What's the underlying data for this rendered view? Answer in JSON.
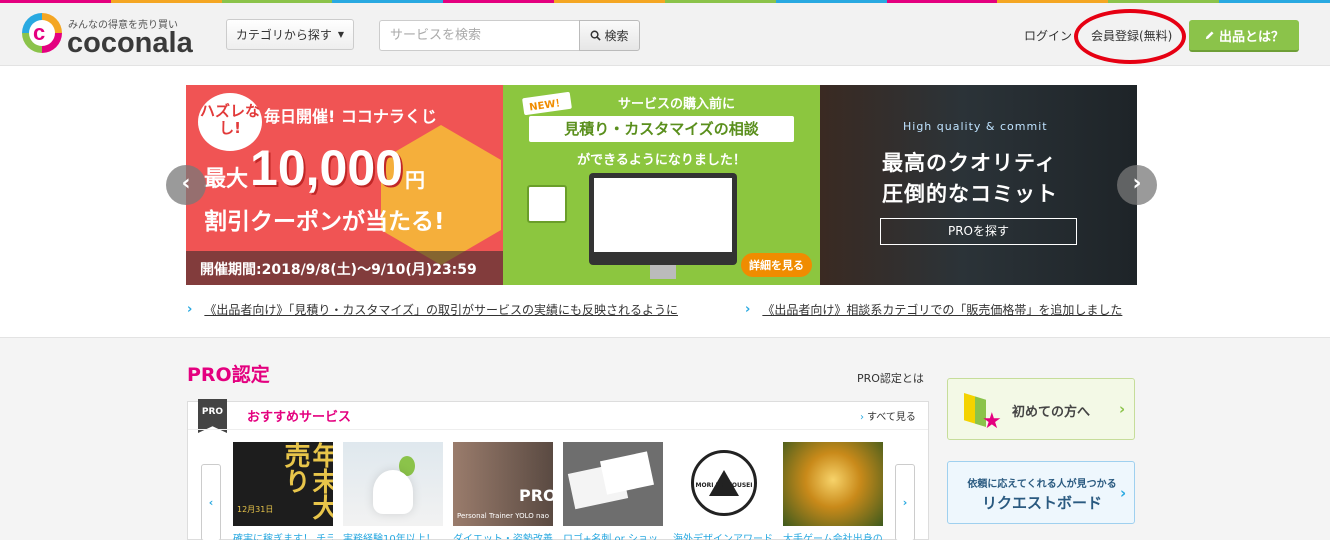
{
  "colors": {
    "brand_pink": "#e4007f",
    "brand_green": "#8bc34a",
    "brand_blue": "#29a9e1",
    "highlight_red": "#e60012",
    "strip": [
      "#e4007f",
      "#f4a623",
      "#8bc34a",
      "#29a9e1",
      "#e4007f",
      "#f4a623",
      "#8bc34a",
      "#29a9e1",
      "#e4007f",
      "#f4a623",
      "#8bc34a",
      "#29a9e1"
    ]
  },
  "header": {
    "logo": {
      "tagline": "みんなの得意を売り買い",
      "wordmark": "coconala",
      "icon": "coconala-logo-icon"
    },
    "category_button": "カテゴリから探す",
    "search": {
      "placeholder": "サービスを検索",
      "value": "",
      "button": "検索",
      "icon": "search-icon"
    },
    "login": "ログイン",
    "register": "会員登録(無料)",
    "sell_button": "出品とは？",
    "sell_icon": "pencil-icon"
  },
  "hero": {
    "prev_icon": "chevron-left-icon",
    "next_icon": "chevron-right-icon",
    "slide1": {
      "badge": "ハズレなし!",
      "headline": "毎日開催! ココナラくじ",
      "prefix": "最大",
      "amount": "10,000",
      "unit": "円",
      "sub": "割引クーポンが当たる!",
      "period": "開催期間:2018/9/8(土)〜9/10(月)23:59"
    },
    "slide2": {
      "new": "NEW！",
      "line1": "サービスの購入前に",
      "line2": "見積り・カスタマイズの相談",
      "line3": "ができるようになりました！",
      "detail": "詳細を見る"
    },
    "slide3": {
      "en": "High quality & commit",
      "line1": "最高のクオリティ",
      "line2": "圧倒的なコミット",
      "button": "PROを探す"
    }
  },
  "news": [
    {
      "text": "《出品者向け》「見積り・カスタマイズ」の取引がサービスの実績にも反映されるように"
    },
    {
      "text": "《出品者向け》相談系カテゴリでの「販売価格帯」を追加しました"
    }
  ],
  "pro_section": {
    "title": "PRO認定",
    "about": "PRO認定とは",
    "flag": "PRO",
    "recommend": "おすすめサービス",
    "see_all": "すべて見る",
    "thumbs": [
      {
        "caption": "確実に稼ぎます！ チラ",
        "overlay": "年末大売り",
        "sub": "12月31日"
      },
      {
        "caption": "実務経験10年以上！"
      },
      {
        "caption": "ダイエット・姿勢改善",
        "overlay": "PRO",
        "sub": "Personal Trainer YOLO nao"
      },
      {
        "caption": "ロゴ+名刺 or ショッ"
      },
      {
        "caption": "海外デザインアワード",
        "overlay": "MORI NO YOUSEI",
        "sub": "BACKCOUNTRY & FISHING"
      },
      {
        "caption": "大手ゲーム会社出身の"
      }
    ]
  },
  "sidebar": {
    "beginner": "初めての方へ",
    "request_small": "依頼に応えてくれる人が見つかる",
    "request_big": "リクエストボード"
  }
}
